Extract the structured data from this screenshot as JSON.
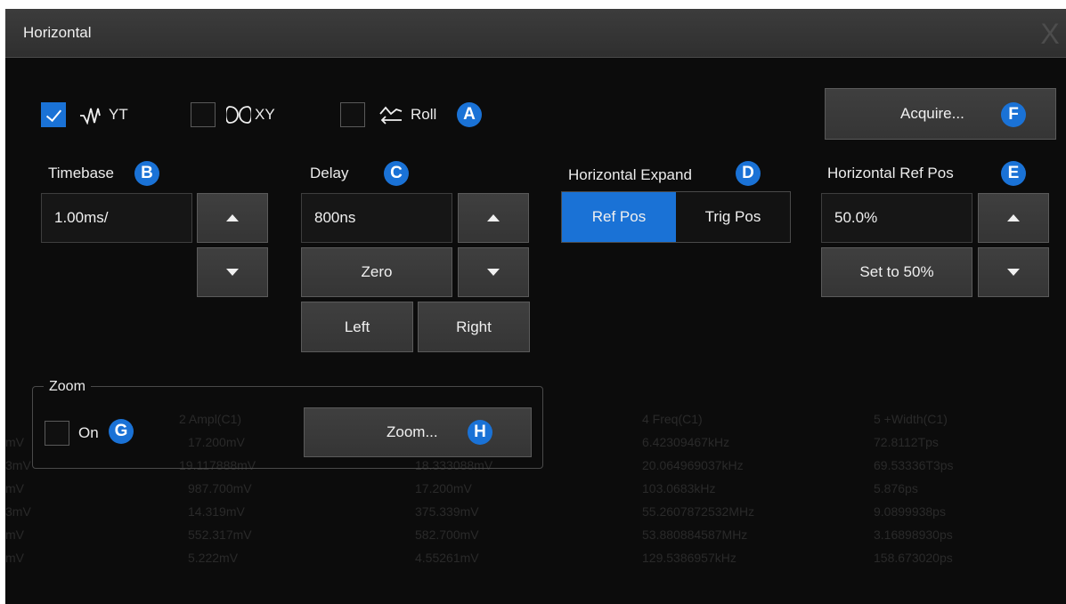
{
  "window": {
    "title": "Horizontal",
    "close_glyph": "X"
  },
  "mode": {
    "yt": {
      "label": "YT",
      "checked": true,
      "icon": "sine-yt-icon"
    },
    "xy": {
      "label": "XY",
      "checked": false,
      "icon": "lissajous-xy-icon"
    },
    "roll": {
      "label": "Roll",
      "checked": false,
      "icon": "roll-arrows-icon"
    }
  },
  "callouts": {
    "A": "A",
    "B": "B",
    "C": "C",
    "D": "D",
    "E": "E",
    "F": "F",
    "G": "G",
    "H": "H"
  },
  "acquire": {
    "label": "Acquire..."
  },
  "timebase": {
    "label": "Timebase",
    "value": "1.00ms/"
  },
  "delay": {
    "label": "Delay",
    "value": "800ns",
    "zero_label": "Zero",
    "left_label": "Left",
    "right_label": "Right"
  },
  "horizontal_expand": {
    "label": "Horizontal Expand",
    "options": [
      "Ref Pos",
      "Trig Pos"
    ],
    "selected": "Ref Pos"
  },
  "ref_pos": {
    "label": "Horizontal Ref Pos",
    "value": "50.0%",
    "set50_label": "Set to 50%"
  },
  "zoom": {
    "group_label": "Zoom",
    "on_label": "On",
    "on_checked": false,
    "button_label": "Zoom..."
  },
  "colors": {
    "accent": "#1a72d6",
    "background": "#0c0c0c",
    "button": "#3a3a3a"
  }
}
